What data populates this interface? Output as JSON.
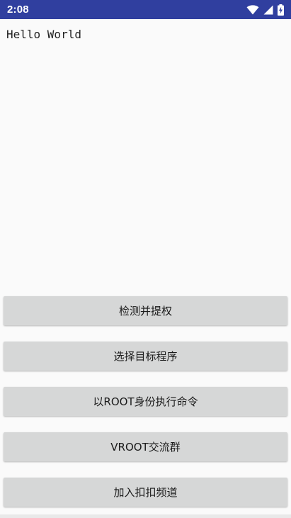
{
  "status_bar": {
    "time": "2:08",
    "icons": [
      "wifi-icon",
      "signal-icon",
      "battery-charging-icon"
    ],
    "color": "#303f9f"
  },
  "main": {
    "hello_text": "Hello World"
  },
  "buttons": [
    {
      "label": "检测并提权"
    },
    {
      "label": "选择目标程序"
    },
    {
      "label": "以ROOT身份执行命令"
    },
    {
      "label": "VROOT交流群"
    },
    {
      "label": "加入扣扣频道"
    }
  ],
  "colors": {
    "background": "#fafafa",
    "button_bg": "#d6d7d7",
    "text": "#1a1a1a"
  }
}
